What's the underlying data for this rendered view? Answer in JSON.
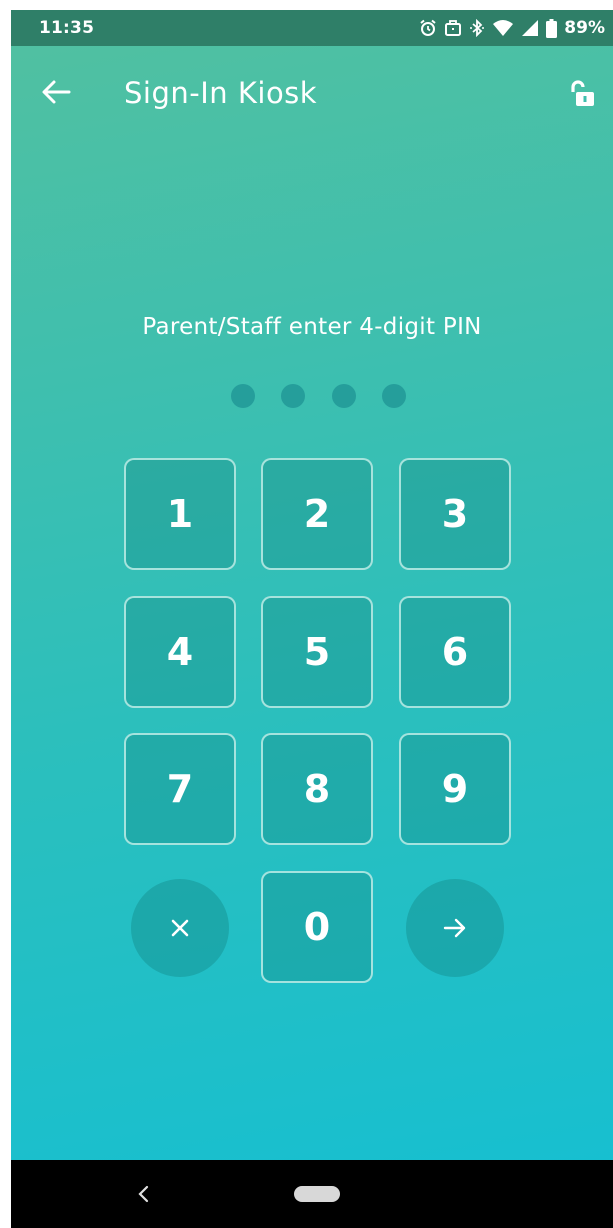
{
  "status_bar": {
    "time": "11:35",
    "battery": "89%",
    "icons": [
      "alarm-icon",
      "work-profile-icon",
      "bluetooth-icon",
      "wifi-icon",
      "signal-icon",
      "battery-icon"
    ]
  },
  "app_bar": {
    "title": "Sign-In Kiosk",
    "back_icon": "arrow-left-icon",
    "lock_icon": "unlock-icon"
  },
  "pin_entry": {
    "prompt": "Parent/Staff enter 4-digit PIN",
    "digits_entered": 0,
    "digits_total": 4
  },
  "keypad": {
    "k1": "1",
    "k2": "2",
    "k3": "3",
    "k4": "4",
    "k5": "5",
    "k6": "6",
    "k7": "7",
    "k8": "8",
    "k9": "9",
    "k0": "0",
    "clear_icon": "close-icon",
    "submit_icon": "arrow-right-icon"
  },
  "colors": {
    "status_bar": "#2f7f68",
    "gradient_top": "#52c0a0",
    "gradient_bottom": "#17bfd0",
    "pin_dot": "#259e9b"
  }
}
